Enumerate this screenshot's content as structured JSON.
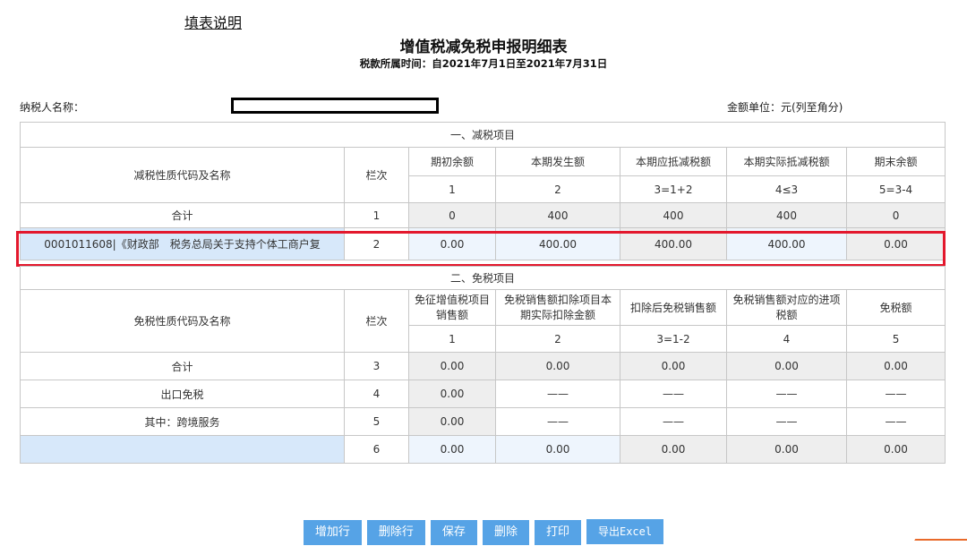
{
  "header": {
    "instructions_link": "填表说明",
    "title": "增值税减免税申报明细表",
    "period": "税款所属时间：自2021年7月1日至2021年7月31日",
    "taxpayer_label": "纳税人名称：",
    "unit_label": "金额单位：元(列至角分)"
  },
  "reduction": {
    "section_title": "一、减税项目",
    "name_header": "减税性质代码及名称",
    "col_header": "栏次",
    "columns": [
      "期初余额",
      "本期发生额",
      "本期应抵减税额",
      "本期实际抵减税额",
      "期末余额"
    ],
    "formulas": [
      "1",
      "2",
      "3=1+2",
      "4≤3",
      "5=3-4"
    ],
    "rows": [
      {
        "name": "合计",
        "line": "1",
        "values": [
          "0",
          "400",
          "400",
          "400",
          "0"
        ]
      },
      {
        "name": "0001011608|《财政部　税务总局关于支持个体工商户复",
        "line": "2",
        "values": [
          "0.00",
          "400.00",
          "400.00",
          "400.00",
          "0.00"
        ]
      }
    ]
  },
  "exemption": {
    "section_title": "二、免税项目",
    "name_header": "免税性质代码及名称",
    "col_header": "栏次",
    "columns": [
      "免征增值税项目销售额",
      "免税销售额扣除项目本期实际扣除金额",
      "扣除后免税销售额",
      "免税销售额对应的进项税额",
      "免税额"
    ],
    "formulas": [
      "1",
      "2",
      "3=1-2",
      "4",
      "5"
    ],
    "rows": [
      {
        "name": "合计",
        "line": "3",
        "values": [
          "0.00",
          "0.00",
          "0.00",
          "0.00",
          "0.00"
        ]
      },
      {
        "name": "出口免税",
        "line": "4",
        "values": [
          "0.00",
          "——",
          "——",
          "——",
          "——"
        ]
      },
      {
        "name": "其中：跨境服务",
        "line": "5",
        "values": [
          "0.00",
          "——",
          "——",
          "——",
          "——"
        ]
      },
      {
        "name": "",
        "line": "6",
        "values": [
          "0.00",
          "0.00",
          "0.00",
          "0.00",
          "0.00"
        ]
      }
    ]
  },
  "buttons": {
    "add_row": "增加行",
    "delete_row": "删除行",
    "save": "保存",
    "delete": "删除",
    "print": "打印",
    "export": "导出Excel"
  }
}
